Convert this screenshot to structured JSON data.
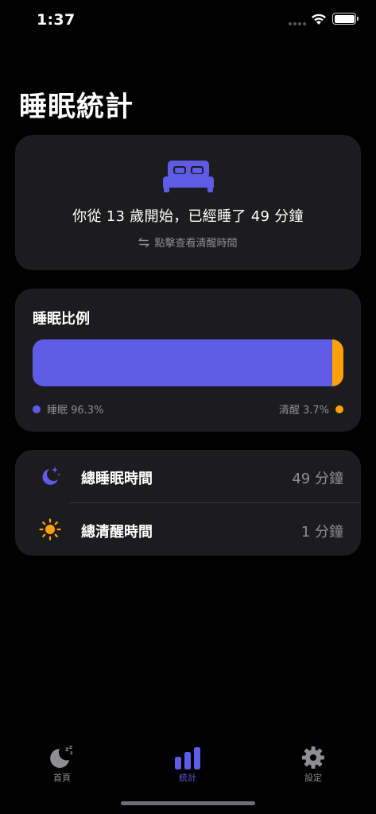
{
  "status_bar": {
    "time": "1:37"
  },
  "page": {
    "title": "睡眠統計"
  },
  "summary": {
    "text": "你從 13 歲開始，已經睡了 49 分鐘",
    "hint": "點擊查看清醒時間",
    "icon": "bed-icon"
  },
  "ratio": {
    "title": "睡眠比例",
    "sleep_percent": 96.3,
    "awake_percent": 3.7,
    "sleep_label": "睡眠 96.3%",
    "awake_label": "清醒 3.7%",
    "sleep_color": "#5e5ce6",
    "awake_color": "#ff9f0a"
  },
  "totals": {
    "rows": [
      {
        "label": "總睡眠時間",
        "value": "49 分鐘",
        "icon": "moon-stars-icon"
      },
      {
        "label": "總清醒時間",
        "value": "1 分鐘",
        "icon": "sun-icon"
      }
    ]
  },
  "tabs": [
    {
      "label": "首頁",
      "icon": "moon-zzz-icon",
      "active": false
    },
    {
      "label": "統計",
      "icon": "bar-chart-icon",
      "active": true
    },
    {
      "label": "設定",
      "icon": "gear-icon",
      "active": false
    }
  ]
}
